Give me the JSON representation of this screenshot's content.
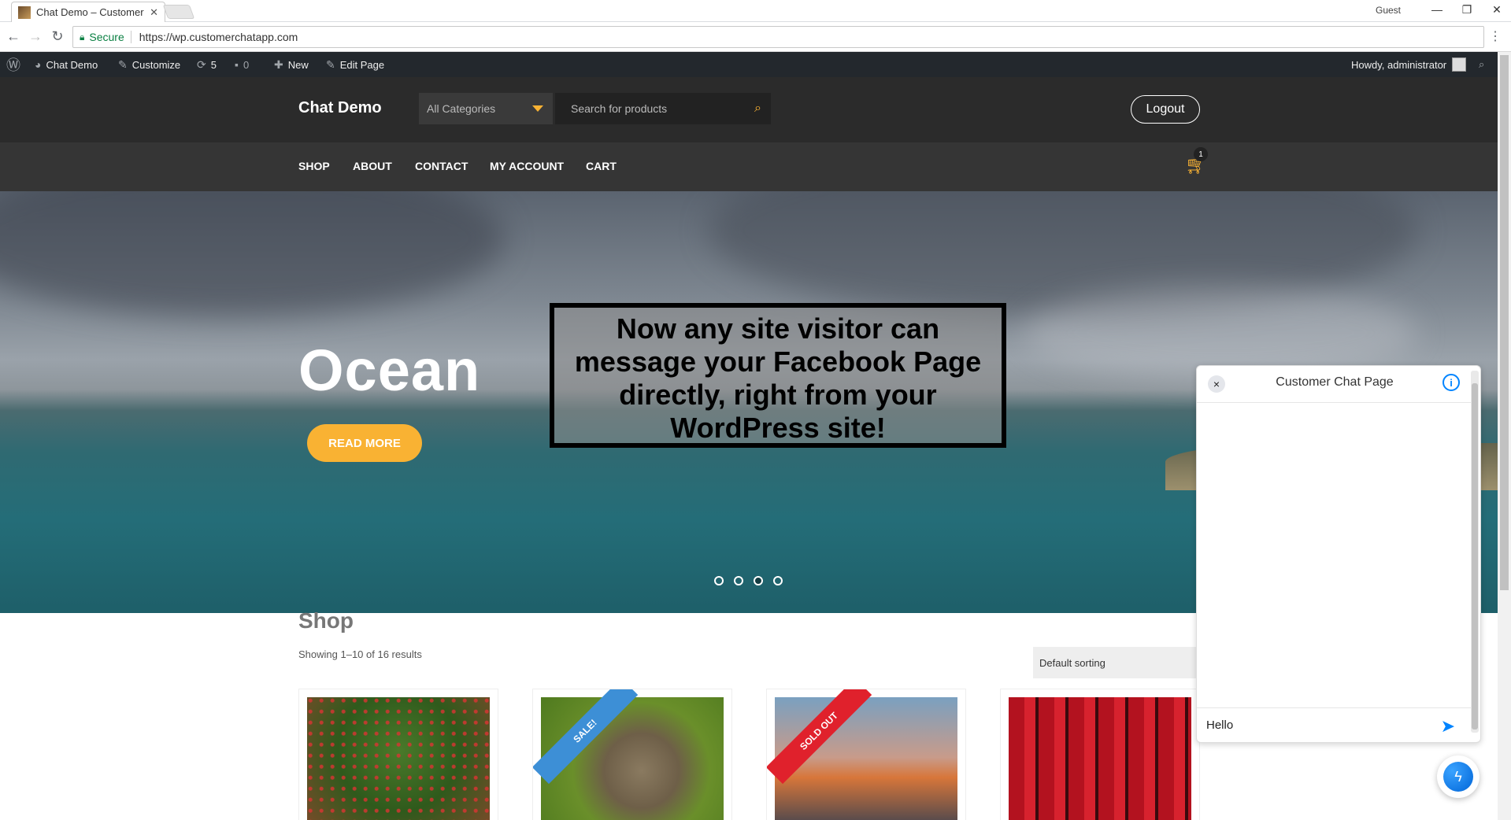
{
  "browser": {
    "tab_title": "Chat Demo – Customer C",
    "tab_close": "✕",
    "profile": "Guest",
    "secure_label": "Secure",
    "url": "https://wp.customerchatapp.com"
  },
  "admin_bar": {
    "site_name": "Chat Demo",
    "customize": "Customize",
    "updates_count": "5",
    "comments_count": "0",
    "new": "New",
    "edit_page": "Edit Page",
    "howdy": "Howdy, administrator"
  },
  "header": {
    "logo": "Chat Demo",
    "category_select": "All Categories",
    "search_placeholder": "Search for products",
    "logout": "Logout"
  },
  "menu": {
    "items": [
      "SHOP",
      "ABOUT",
      "CONTACT",
      "MY ACCOUNT",
      "CART"
    ],
    "cart_count": "1"
  },
  "hero": {
    "title": "Ocean",
    "button": "READ MORE",
    "overlay_text": "Now any site visitor can message your Facebook Page directly, right from your WordPress site!",
    "slide_count": 4,
    "active_slide": 3
  },
  "shop": {
    "title": "Shop",
    "result_count": "Showing 1–10 of 16 results",
    "sort": "Default sorting",
    "products": [
      {
        "ribbon": ""
      },
      {
        "ribbon": "SALE!"
      },
      {
        "ribbon": "SOLD OUT"
      },
      {
        "ribbon": ""
      }
    ]
  },
  "chat": {
    "title": "Customer Chat Page",
    "input_value": "Hello",
    "close_icon": "×",
    "info_icon": "i"
  },
  "colors": {
    "accent": "#f9b233",
    "admin_bar": "#23282d",
    "header": "#2b2b2b",
    "menu": "#353535",
    "messenger_blue": "#0084ff",
    "sale_ribbon": "#3d8fd6",
    "soldout_ribbon": "#e0212c"
  }
}
